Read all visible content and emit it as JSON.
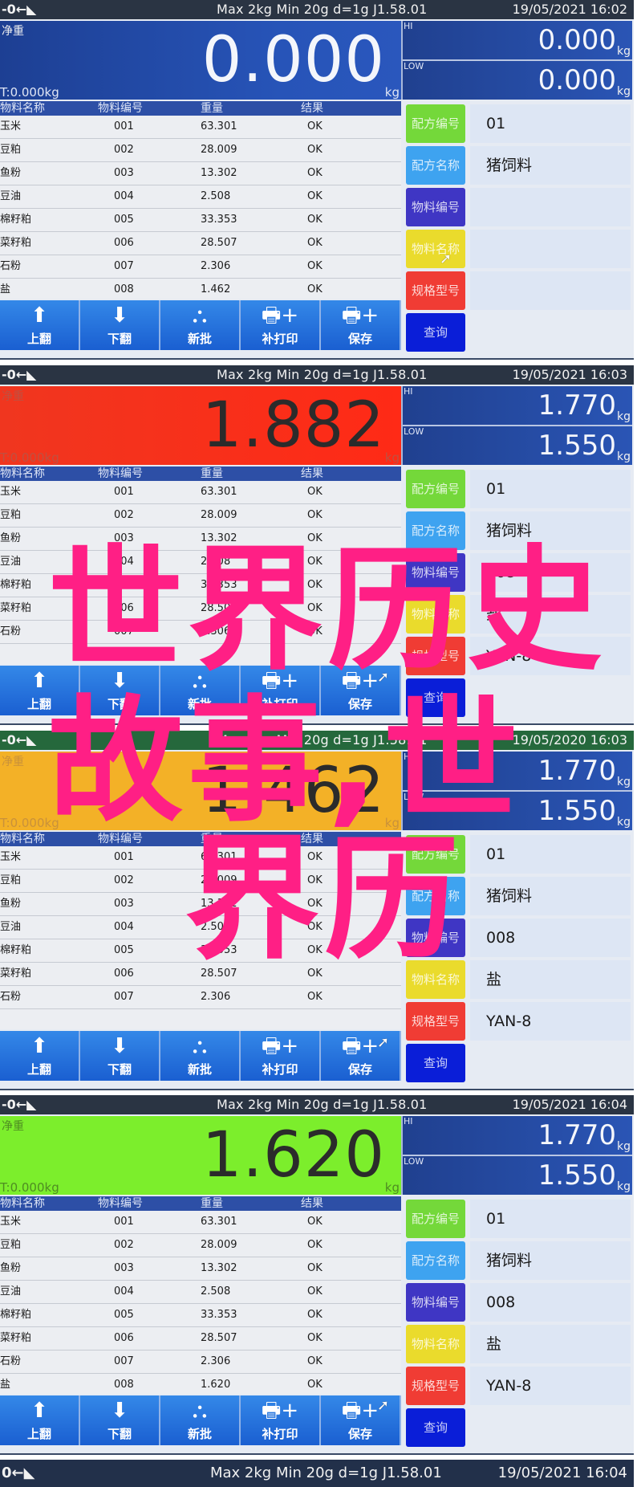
{
  "status_bar": {
    "indicator": "-0←◣",
    "spec": "Max 2kg  Min 20g  d=1g    J1.58.01"
  },
  "labels": {
    "net_weight": "净重",
    "hi": "HI",
    "low": "LOW",
    "unit": "kg"
  },
  "table_headers": [
    "物料名称",
    "物料编号",
    "重量",
    "结果"
  ],
  "toolbar": [
    {
      "icon": "arrow-up-icon",
      "glyph": "⬆",
      "label": "上翻"
    },
    {
      "icon": "arrow-down-icon",
      "glyph": "⬇",
      "label": "下翻"
    },
    {
      "icon": "stack-icon",
      "glyph": "⛬",
      "label": "新批"
    },
    {
      "icon": "printer-plus-icon",
      "glyph": "🖶+",
      "label": "补打印"
    },
    {
      "icon": "printer-plus-icon",
      "glyph": "🖶+",
      "label": "保存"
    }
  ],
  "side_buttons": [
    {
      "label": "配方编号",
      "color": "#74d83a"
    },
    {
      "label": "配方名称",
      "color": "#3ea3f0"
    },
    {
      "label": "物料编号",
      "color": "#3f36c4"
    },
    {
      "label": "物料名称",
      "color": "#eadb2c"
    },
    {
      "label": "规格型号",
      "color": "#f03c34"
    },
    {
      "label": "查询",
      "color": "#0a1ed8"
    }
  ],
  "panels": [
    {
      "datetime": "19/05/2021  16:02",
      "net_weight": "0.000",
      "tare": "T:0.000kg",
      "display_color": "blue",
      "hi": "0.000",
      "low": "0.000",
      "rows": [
        [
          "玉米",
          "001",
          "63.301",
          "OK"
        ],
        [
          "豆粕",
          "002",
          "28.009",
          "OK"
        ],
        [
          "鱼粉",
          "003",
          "13.302",
          "OK"
        ],
        [
          "豆油",
          "004",
          "2.508",
          "OK"
        ],
        [
          "棉籽粕",
          "005",
          "33.353",
          "OK"
        ],
        [
          "菜籽粕",
          "006",
          "28.507",
          "OK"
        ],
        [
          "石粉",
          "007",
          "2.306",
          "OK"
        ],
        [
          "盐",
          "008",
          "1.462",
          "OK"
        ]
      ],
      "side_values": [
        "01",
        "猪饲料",
        "",
        "",
        "",
        ""
      ]
    },
    {
      "datetime": "19/05/2021  16:03",
      "net_weight": "1.882",
      "tare": "T:0.000kg",
      "display_color": "red",
      "hi": "1.770",
      "low": "1.550",
      "rows": [
        [
          "玉米",
          "001",
          "63.301",
          "OK"
        ],
        [
          "豆粕",
          "002",
          "28.009",
          "OK"
        ],
        [
          "鱼粉",
          "003",
          "13.302",
          "OK"
        ],
        [
          "豆油",
          "004",
          "2.508",
          "OK"
        ],
        [
          "棉籽粕",
          "005",
          "33.353",
          "OK"
        ],
        [
          "菜籽粕",
          "006",
          "28.507",
          "OK"
        ],
        [
          "石粉",
          "007",
          "2.306",
          "OK"
        ],
        [
          "",
          "",
          "",
          ""
        ]
      ],
      "side_values": [
        "01",
        "猪饲料",
        "008",
        "盐",
        "YAN-8",
        ""
      ]
    },
    {
      "datetime": "19/05/2020  16:03",
      "net_weight": "1.462",
      "tare": "T:0.000kg",
      "display_color": "yellow",
      "hi": "1.770",
      "low": "1.550",
      "rows": [
        [
          "玉米",
          "001",
          "63.301",
          "OK"
        ],
        [
          "豆粕",
          "002",
          "28.009",
          "OK"
        ],
        [
          "鱼粉",
          "003",
          "13.302",
          "OK"
        ],
        [
          "豆油",
          "004",
          "2.508",
          "OK"
        ],
        [
          "棉籽粕",
          "005",
          "33.353",
          "OK"
        ],
        [
          "菜籽粕",
          "006",
          "28.507",
          "OK"
        ],
        [
          "石粉",
          "007",
          "2.306",
          "OK"
        ],
        [
          "",
          "",
          "",
          ""
        ]
      ],
      "side_values": [
        "01",
        "猪饲料",
        "008",
        "盐",
        "YAN-8",
        ""
      ]
    },
    {
      "datetime": "19/05/2021  16:04",
      "net_weight": "1.620",
      "tare": "T:0.000kg",
      "display_color": "green",
      "hi": "1.770",
      "low": "1.550",
      "rows": [
        [
          "玉米",
          "001",
          "63.301",
          "OK"
        ],
        [
          "豆粕",
          "002",
          "28.009",
          "OK"
        ],
        [
          "鱼粉",
          "003",
          "13.302",
          "OK"
        ],
        [
          "豆油",
          "004",
          "2.508",
          "OK"
        ],
        [
          "棉籽粕",
          "005",
          "33.353",
          "OK"
        ],
        [
          "菜籽粕",
          "006",
          "28.507",
          "OK"
        ],
        [
          "石粉",
          "007",
          "2.306",
          "OK"
        ],
        [
          "盐",
          "008",
          "1.620",
          "OK"
        ]
      ],
      "side_values": [
        "01",
        "猪饲料",
        "008",
        "盐",
        "YAN-8",
        ""
      ]
    }
  ],
  "footer_bar": {
    "indicator": "0←◣",
    "spec": "Max 2kg  Min 20g  d=1g    J1.58.01",
    "datetime": "19/05/2021  16:04"
  },
  "overlay": {
    "line1": "世界历史",
    "line2": "故事,世",
    "line3": "界历",
    "color": "#ff1f85"
  }
}
